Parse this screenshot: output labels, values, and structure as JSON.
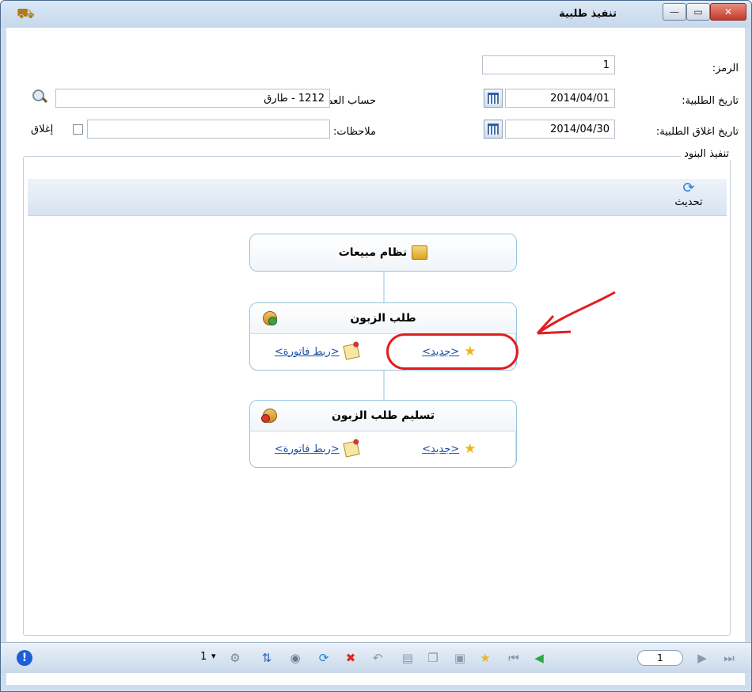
{
  "window": {
    "title": "تنفيذ طلبية",
    "app_icon": "app-icon",
    "controls": {
      "close": "✕",
      "maximize": "▭",
      "minimize": "—"
    }
  },
  "form": {
    "code_label": "الرمز:",
    "code_value": "1",
    "order_date_label": "تاريخ الطلبية:",
    "order_date_value": "2014/04/01",
    "customer_label": "حساب العميل:",
    "customer_value": "1212 - طارق",
    "close_date_label": "تاريخ اغلاق الطلبية:",
    "close_date_value": "2014/04/30",
    "notes_label": "ملاحظات:",
    "notes_value": "",
    "close_checkbox_label": "إغلاق"
  },
  "items_group": {
    "title": "تنفيذ البنود",
    "refresh_label": "تحديث"
  },
  "flow": {
    "sales_system": "نظام مبيعات",
    "customer_order": {
      "title": "طلب الزبون",
      "link_invoice": "<ربط فاتورة>",
      "link_new": "<جديد>"
    },
    "delivery": {
      "title": "تسليم طلب الزبون",
      "link_invoice": "<ربط فاتورة>",
      "link_new": "<جديد>"
    }
  },
  "statusbar": {
    "page_value": "1",
    "selector_value": "1",
    "dropdown_glyph": "▾"
  },
  "colors": {
    "annotation": "#e21d1d",
    "link": "#1a4fa8"
  }
}
